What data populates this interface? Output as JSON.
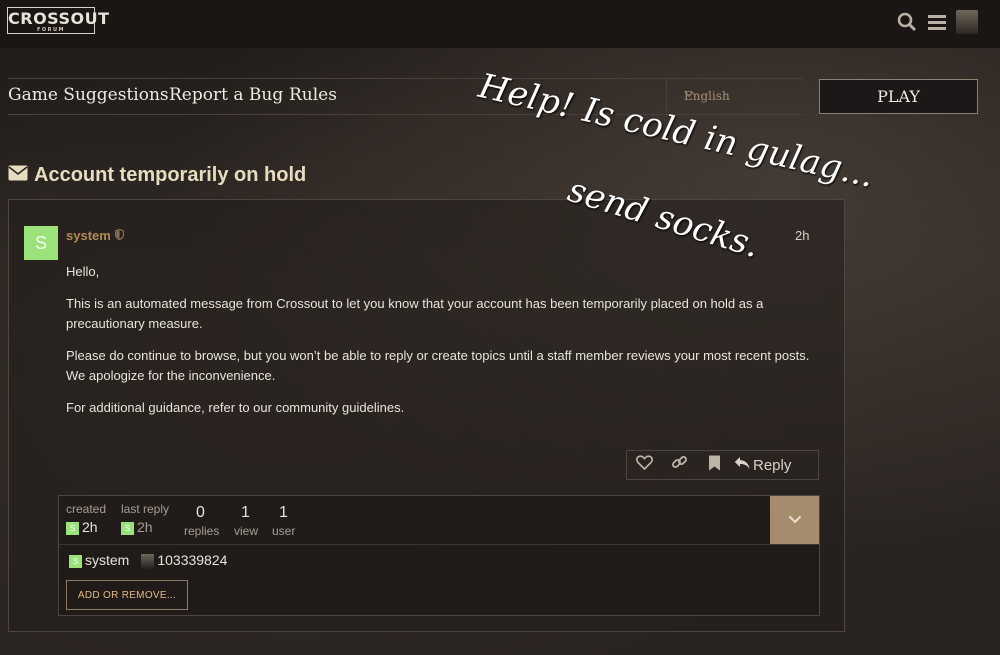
{
  "header": {
    "logo_text": "CROSSOUT",
    "logo_sub": "FORUM",
    "icons": [
      "search-icon",
      "menu-icon",
      "user-avatar"
    ]
  },
  "nav": {
    "links": [
      "Game Suggestions",
      "Report a Bug",
      "Rules"
    ],
    "language": "English",
    "play_label": "PLAY"
  },
  "topic": {
    "title": "Account temporarily on hold",
    "title_icon": "envelope-icon"
  },
  "post": {
    "avatar_letter": "S",
    "username": "system",
    "time": "2h",
    "paragraphs": [
      "Hello,",
      "This is an automated message from Crossout to let you know that your account has been temporarily placed on hold as a precautionary measure.",
      "Please do continue to browse, but you won’t be able to reply or create topics until a staff member reviews your most recent posts. We apologize for the inconvenience.",
      "For additional guidance, refer to our community guidelines."
    ],
    "reply_label": "Reply"
  },
  "topic_map": {
    "created_label": "created",
    "created_value": "2h",
    "last_reply_label": "last reply",
    "last_reply_value": "2h",
    "replies_value": "0",
    "replies_label": "replies",
    "views_value": "1",
    "views_label": "view",
    "users_value": "1",
    "users_label": "user",
    "participants": [
      "system",
      "103339824"
    ],
    "add_remove_label": "ADD OR REMOVE..."
  },
  "overlay": {
    "line1": "Help! Is cold in gulag...",
    "line2": "send socks."
  },
  "colors": {
    "accent": "#a58c6c",
    "username": "#b08a55",
    "avatar_green": "#9be27a"
  }
}
